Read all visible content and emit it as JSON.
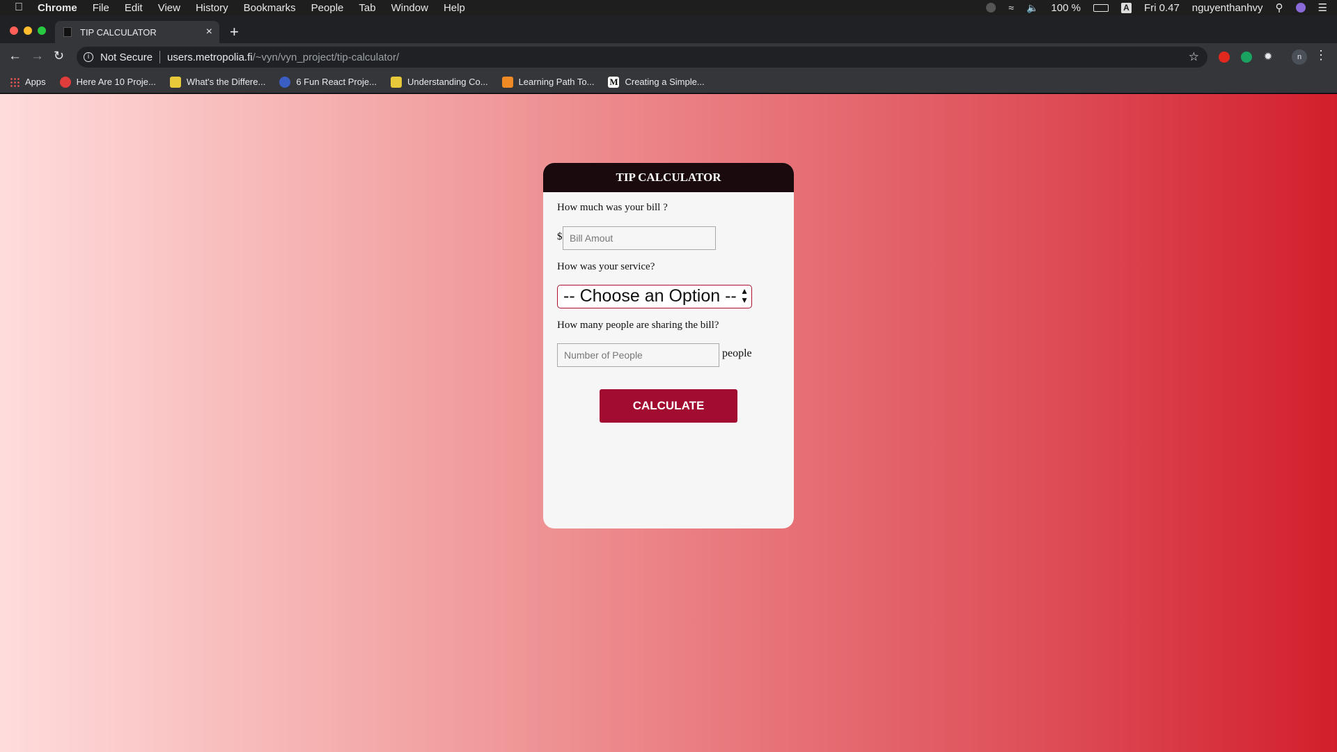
{
  "menubar": {
    "app": "Chrome",
    "items": [
      "File",
      "Edit",
      "View",
      "History",
      "Bookmarks",
      "People",
      "Tab",
      "Window",
      "Help"
    ],
    "battery": "100 %",
    "input_source": "A",
    "clock": "Fri 0.47",
    "user": "nguyenthanhvy"
  },
  "browser": {
    "tab_title": "TIP CALCULATOR",
    "new_tab": "+",
    "close": "×",
    "security": "Not Secure",
    "url_host": "users.metropolia.fi",
    "url_path": "/~vyn/vyn_project/tip-calculator/",
    "profile_initial": "n"
  },
  "bookmarks": [
    {
      "label": "Apps",
      "color": "#e04646"
    },
    {
      "label": "Here Are 10 Proje...",
      "color": "#e03c3c"
    },
    {
      "label": "What's the Differe...",
      "color": "#e8c93a"
    },
    {
      "label": "6 Fun React Proje...",
      "color": "#3a5ec4"
    },
    {
      "label": "Understanding Co...",
      "color": "#e8c93a"
    },
    {
      "label": "Learning Path To...",
      "color": "#f08a24"
    },
    {
      "label": "Creating a Simple...",
      "color": "#111111"
    }
  ],
  "calculator": {
    "title": "TIP CALCULATOR",
    "bill_question": "How much was your bill ?",
    "currency": "$",
    "bill_placeholder": "Bill Amout",
    "service_question": "How was your service?",
    "service_selected": "-- Choose an Option --",
    "people_question": "How many people are sharing the bill?",
    "people_placeholder": "Number of People",
    "people_unit": "people",
    "button": "CALCULATE"
  },
  "colors": {
    "header": "#1b0a0d",
    "button": "#a30c31",
    "gradient_start": "#ffdcdc",
    "gradient_end": "#d21f2c"
  }
}
